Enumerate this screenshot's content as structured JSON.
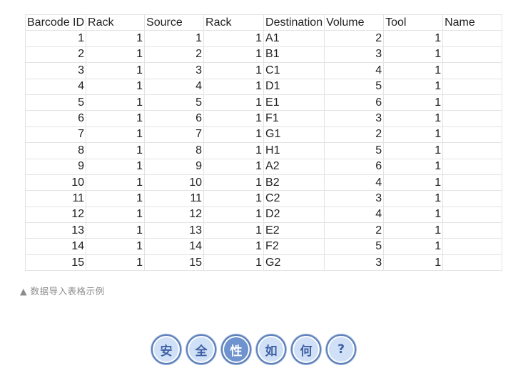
{
  "table": {
    "headers": [
      "Barcode ID",
      "Rack",
      "Source",
      "Rack",
      "Destination",
      "Volume",
      "Tool",
      "Name"
    ],
    "rows": [
      [
        "1",
        "1",
        "1",
        "1",
        "A1",
        "2",
        "1",
        ""
      ],
      [
        "2",
        "1",
        "2",
        "1",
        "B1",
        "3",
        "1",
        ""
      ],
      [
        "3",
        "1",
        "3",
        "1",
        "C1",
        "4",
        "1",
        ""
      ],
      [
        "4",
        "1",
        "4",
        "1",
        "D1",
        "5",
        "1",
        ""
      ],
      [
        "5",
        "1",
        "5",
        "1",
        "E1",
        "6",
        "1",
        ""
      ],
      [
        "6",
        "1",
        "6",
        "1",
        "F1",
        "3",
        "1",
        ""
      ],
      [
        "7",
        "1",
        "7",
        "1",
        "G1",
        "2",
        "1",
        ""
      ],
      [
        "8",
        "1",
        "8",
        "1",
        "H1",
        "5",
        "1",
        ""
      ],
      [
        "9",
        "1",
        "9",
        "1",
        "A2",
        "6",
        "1",
        ""
      ],
      [
        "10",
        "1",
        "10",
        "1",
        "B2",
        "4",
        "1",
        ""
      ],
      [
        "11",
        "1",
        "11",
        "1",
        "C2",
        "3",
        "1",
        ""
      ],
      [
        "12",
        "1",
        "12",
        "1",
        "D2",
        "4",
        "1",
        ""
      ],
      [
        "13",
        "1",
        "13",
        "1",
        "E2",
        "2",
        "1",
        ""
      ],
      [
        "14",
        "1",
        "14",
        "1",
        "F2",
        "5",
        "1",
        ""
      ],
      [
        "15",
        "1",
        "15",
        "1",
        "G2",
        "3",
        "1",
        ""
      ]
    ]
  },
  "caption": "▲ 数据导入表格示例",
  "badges": [
    {
      "char": "安",
      "style": "normal"
    },
    {
      "char": "全",
      "style": "normal"
    },
    {
      "char": "性",
      "style": "alt"
    },
    {
      "char": "如",
      "style": "normal"
    },
    {
      "char": "何",
      "style": "normal"
    },
    {
      "char": "?",
      "style": "normal"
    }
  ]
}
